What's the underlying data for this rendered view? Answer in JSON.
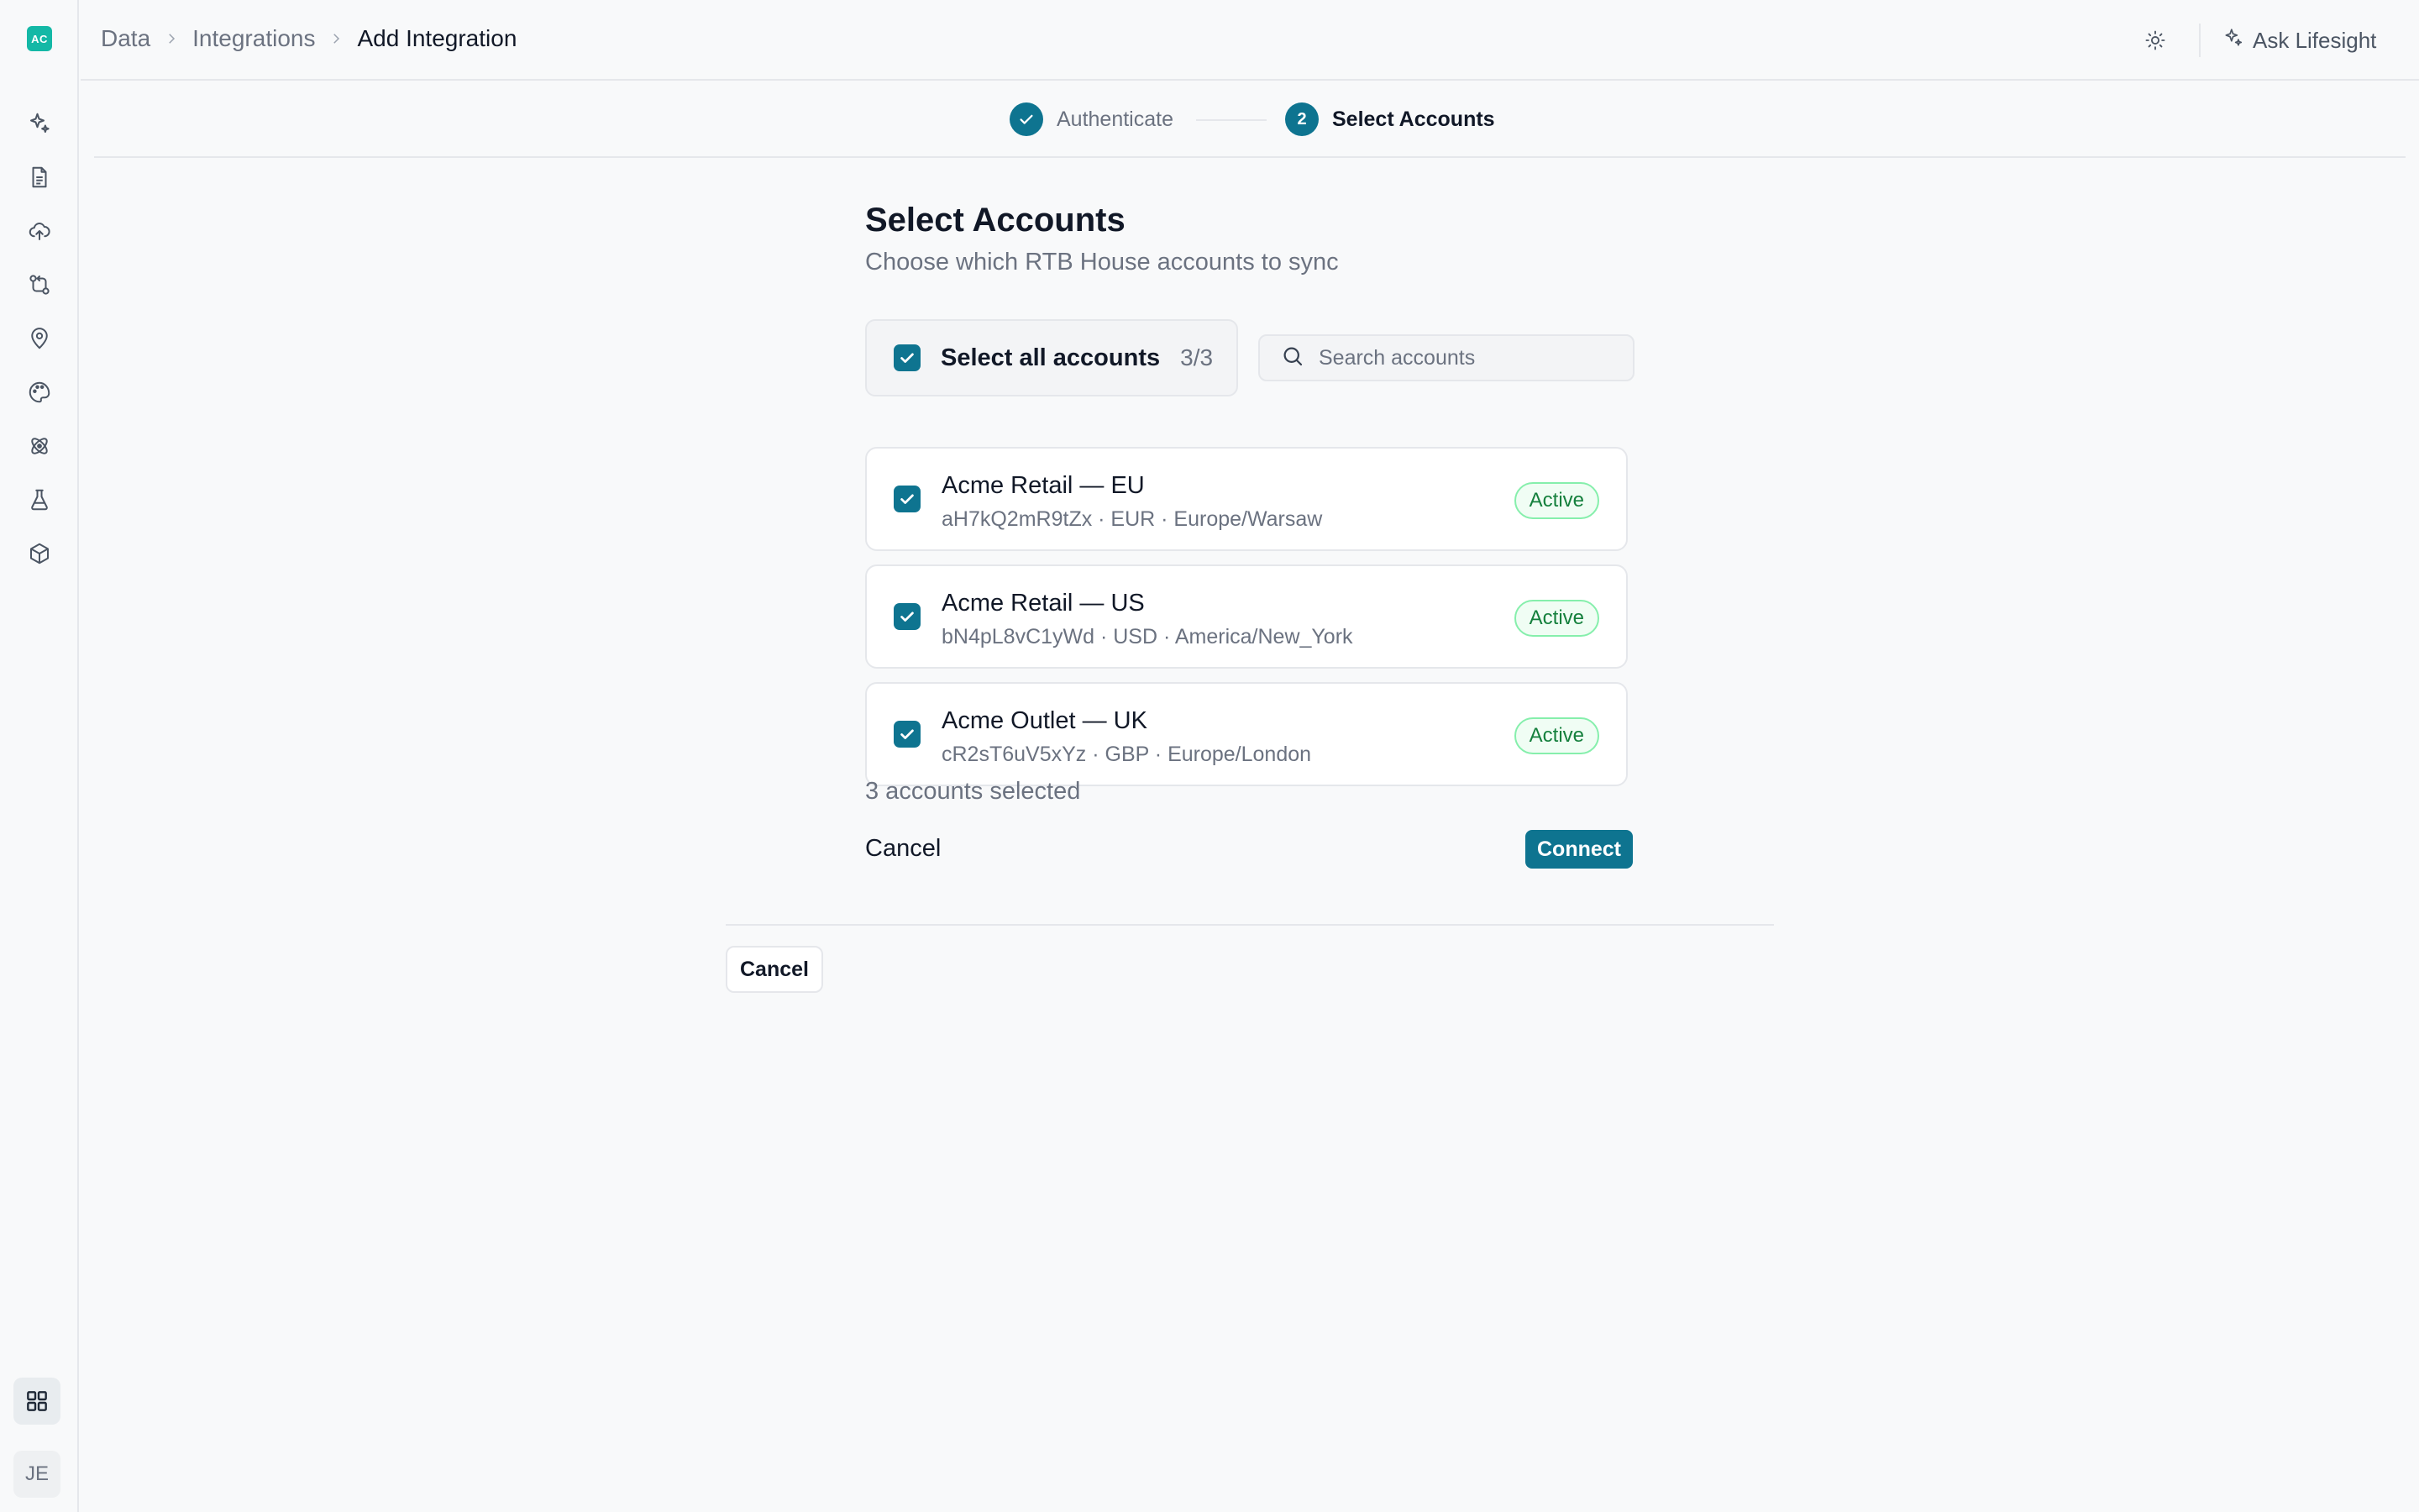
{
  "app": {
    "logo_text": "AC",
    "avatar_initials": "JE",
    "accent_color": "#0e7490",
    "logo_color": "#14b8a6"
  },
  "sidebar": {
    "icons": [
      "sparkles-icon",
      "document-icon",
      "cloud-upload-icon",
      "git-compare-icon",
      "map-pin-icon",
      "palette-icon",
      "atom-icon",
      "flask-icon",
      "cube-icon"
    ],
    "bottom_icon": "grid-icon"
  },
  "header": {
    "breadcrumb": [
      "Data",
      "Integrations",
      "Add Integration"
    ],
    "theme_icon": "sun-icon",
    "ask_label": "Ask Lifesight"
  },
  "stepper": {
    "steps": [
      {
        "label": "Authenticate",
        "state": "complete"
      },
      {
        "number": "2",
        "label": "Select Accounts",
        "state": "current"
      }
    ]
  },
  "main": {
    "title": "Select Accounts",
    "subtitle": "Choose which RTB House accounts to sync",
    "select_all_label": "Select all accounts",
    "select_all_count": "3/3",
    "search_placeholder": "Search accounts",
    "accounts": [
      {
        "name": "Acme Retail — EU",
        "meta": "aH7kQ2mR9tZx · EUR · Europe/Warsaw",
        "status": "Active",
        "checked": true
      },
      {
        "name": "Acme Retail — US",
        "meta": "bN4pL8vC1yWd · USD · America/New_York",
        "status": "Active",
        "checked": true
      },
      {
        "name": "Acme Outlet — UK",
        "meta": "cR2sT6uV5xYz · GBP · Europe/London",
        "status": "Active",
        "checked": true
      }
    ],
    "selected_count_text": "3 accounts selected",
    "cancel_label": "Cancel",
    "connect_label": "Connect"
  },
  "footer": {
    "cancel_label": "Cancel"
  }
}
